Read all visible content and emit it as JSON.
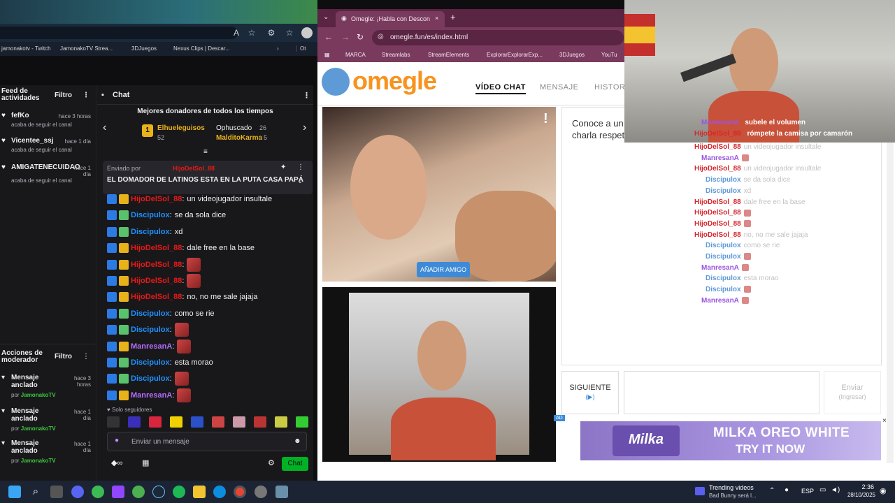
{
  "left_browser": {
    "bookmarks": [
      "jamonakotv - Twitch",
      "JamonakoTV Strea...",
      "3DJuegos",
      "Nexus Clips | Descar...",
      "Ot"
    ]
  },
  "feed": {
    "title": "Feed de actividades",
    "filter_label": "Filtro",
    "items": [
      {
        "name": "fefKo",
        "time": "hace 3 horas",
        "action": "acaba de seguir el canal"
      },
      {
        "name": "Vicentee_ssj",
        "time": "hace 1 día",
        "action": "acaba de seguir el canal"
      },
      {
        "name": "AMIGATENECUIDAO",
        "time": "hace 1 día",
        "action": "acaba de seguir el canal"
      }
    ]
  },
  "mod_actions": {
    "title": "Acciones de moderador",
    "filter_label": "Filtro",
    "items": [
      {
        "action": "Mensaje anclado",
        "time": "hace 3 horas",
        "by_label": "por",
        "by": "JamonakoTV"
      },
      {
        "action": "Mensaje anclado",
        "time": "hace 1 día",
        "by_label": "por",
        "by": "JamonakoTV"
      },
      {
        "action": "Mensaje anclado",
        "time": "hace 1 día",
        "by_label": "por",
        "by": "JamonakoTV"
      }
    ]
  },
  "chat": {
    "title": "Chat",
    "donors_title": "Mejores donadores de todos los tiempos",
    "donors": [
      {
        "rank": "1",
        "name": "Elhueleguisos",
        "amount": "52"
      },
      {
        "rank": "",
        "name": "Ophuscado",
        "amount": "26"
      },
      {
        "rank": "",
        "name": "MalditoKarma",
        "amount": "5"
      }
    ],
    "pinned": {
      "sent_by_label": "Enviado por",
      "sent_by": "HijoDelSol_88",
      "text": "EL DOMADOR DE LATINOS ESTA EN LA PUTA CASA PAPÁ"
    },
    "messages": [
      {
        "user": "HijoDelSol_88",
        "color": "#e91916",
        "text": "un videojugador insultale",
        "badge": "crown"
      },
      {
        "user": "Discipulox",
        "color": "#1e90ff",
        "text": "se da sola dice",
        "badge": "sub"
      },
      {
        "user": "Discipulox",
        "color": "#1e90ff",
        "text": "xd",
        "badge": "sub"
      },
      {
        "user": "HijoDelSol_88",
        "color": "#e91916",
        "text": "dale free en la base",
        "badge": "crown"
      },
      {
        "user": "HijoDelSol_88",
        "color": "#e91916",
        "text": "",
        "badge": "crown",
        "emote": true
      },
      {
        "user": "HijoDelSol_88",
        "color": "#e91916",
        "text": "",
        "badge": "crown",
        "emote": true
      },
      {
        "user": "HijoDelSol_88",
        "color": "#e91916",
        "text": "no, no me sale jajaja",
        "badge": "crown"
      },
      {
        "user": "Discipulox",
        "color": "#1e90ff",
        "text": "como se rie",
        "badge": "sub"
      },
      {
        "user": "Discipulox",
        "color": "#1e90ff",
        "text": "",
        "badge": "sub",
        "emote": true
      },
      {
        "user": "ManresanA",
        "color": "#b56eff",
        "text": "",
        "badge": "crown",
        "emote": true
      },
      {
        "user": "Discipulox",
        "color": "#1e90ff",
        "text": "esta morao",
        "badge": "sub"
      },
      {
        "user": "Discipulox",
        "color": "#1e90ff",
        "text": "",
        "badge": "sub",
        "emote": true
      },
      {
        "user": "ManresanA",
        "color": "#b56eff",
        "text": "",
        "badge": "crown",
        "emote": true
      }
    ],
    "followers_only": "Solo seguidores",
    "input_placeholder": "Enviar un mensaje",
    "send_label": "Chat"
  },
  "right_browser": {
    "tab_title": "Omegle: ¡Habla con Descon",
    "url": "omegle.fun/es/index.html",
    "bookmarks": [
      "MARCA",
      "Streamlabs",
      "StreamElements",
      "ExplorarExplorarExp...",
      "3DJuegos",
      "YouTu"
    ]
  },
  "omegle": {
    "logo": "omegle",
    "nav": [
      "VÍDEO CHAT",
      "MENSAJE",
      "HISTORI"
    ],
    "add_friend": "AÑADIR AMIGO",
    "intro": "Conoce a un\ncharla respet",
    "next_label": "SIGUIENTE",
    "next_sub": "(▶)",
    "send_label": "Enviar",
    "send_sub": "(Ingresar)",
    "ad_tag": "AD",
    "ad_brand": "Milka",
    "ad_line1": "MILKA OREO WHITE",
    "ad_line2": "TRY IT NOW"
  },
  "overlay_chat": [
    {
      "user": "HijoDelSol_88",
      "cls": "c-red",
      "text": "un videojugador insultale"
    },
    {
      "user": "ManresanA",
      "cls": "c-purple",
      "text": ""
    },
    {
      "user": "HijoDelSol_88",
      "cls": "c-red",
      "text": "un videojugador insultale"
    },
    {
      "user": "Discipulox",
      "cls": "c-blue",
      "text": "se da sola dice"
    },
    {
      "user": "Discipulox",
      "cls": "c-blue",
      "text": "xd"
    },
    {
      "user": "HijoDelSol_88",
      "cls": "c-red",
      "text": "dale free en la base"
    },
    {
      "user": "HijoDelSol_88",
      "cls": "c-red",
      "text": ""
    },
    {
      "user": "HijoDelSol_88",
      "cls": "c-red",
      "text": ""
    },
    {
      "user": "HijoDelSol_88",
      "cls": "c-red",
      "text": "no, no me sale jajaja"
    },
    {
      "user": "Discipulox",
      "cls": "c-blue",
      "text": "como se rie"
    },
    {
      "user": "Discipulox",
      "cls": "c-blue",
      "text": ""
    },
    {
      "user": "ManresanA",
      "cls": "c-purple",
      "text": ""
    },
    {
      "user": "Discipulox",
      "cls": "c-blue",
      "text": "esta morao"
    },
    {
      "user": "Discipulox",
      "cls": "c-blue",
      "text": ""
    },
    {
      "user": "ManresanA",
      "cls": "c-purple",
      "text": ""
    }
  ],
  "cam_overlay": [
    {
      "user": "ManresanA",
      "text": "subele el volumen"
    },
    {
      "user": "HijoDelSol_88",
      "text": "rómpete la camisa por camarón"
    }
  ],
  "taskbar": {
    "trending_title": "Trending videos",
    "trending_sub": "Bad Bunny será l...",
    "lang": "ESP",
    "time": "2:36",
    "date": "28/10/2025"
  }
}
